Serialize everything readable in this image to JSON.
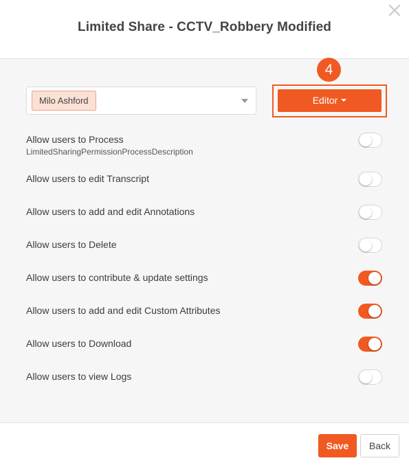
{
  "dialog": {
    "title": "Limited Share - CCTV_Robbery Modified",
    "close_icon": "close-icon"
  },
  "share": {
    "selected_user": "Milo Ashford",
    "role_label": "Editor",
    "step_badge": "4",
    "accent_color": "#f05a22"
  },
  "permissions": [
    {
      "label": "Allow users to Process",
      "description": "LimitedSharingPermissionProcessDescription",
      "enabled": false
    },
    {
      "label": "Allow users to edit Transcript",
      "enabled": false
    },
    {
      "label": "Allow users to add and edit Annotations",
      "enabled": false
    },
    {
      "label": "Allow users to Delete",
      "enabled": false
    },
    {
      "label": "Allow users to contribute & update settings",
      "enabled": true
    },
    {
      "label": "Allow users to add and edit Custom Attributes",
      "enabled": true
    },
    {
      "label": "Allow users to Download",
      "enabled": true
    },
    {
      "label": "Allow users to view Logs",
      "enabled": false
    }
  ],
  "footer": {
    "save_label": "Save",
    "back_label": "Back"
  }
}
